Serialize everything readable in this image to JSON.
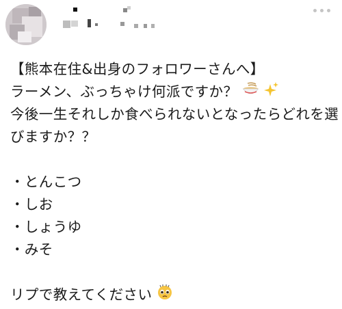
{
  "post": {
    "heading": "【熊本在住&出身のフォロワーさんへ】",
    "question": "ラーメン、ぶっちゃけ何派ですか？",
    "line3": "今後一生それしか食べられないとなったらどれを選",
    "line4": "びますか？？",
    "options": [
      "・とんこつ",
      "・しお",
      "・しょうゆ",
      "・みそ"
    ],
    "closing": "リプで教えてください"
  },
  "icons": {
    "avatar": "blurred-avatar",
    "more": "more-options-icon",
    "ramen": "ramen-bowl-emoji",
    "sparkles": "sparkles-emoji",
    "pleading": "pleading-face-emoji"
  }
}
